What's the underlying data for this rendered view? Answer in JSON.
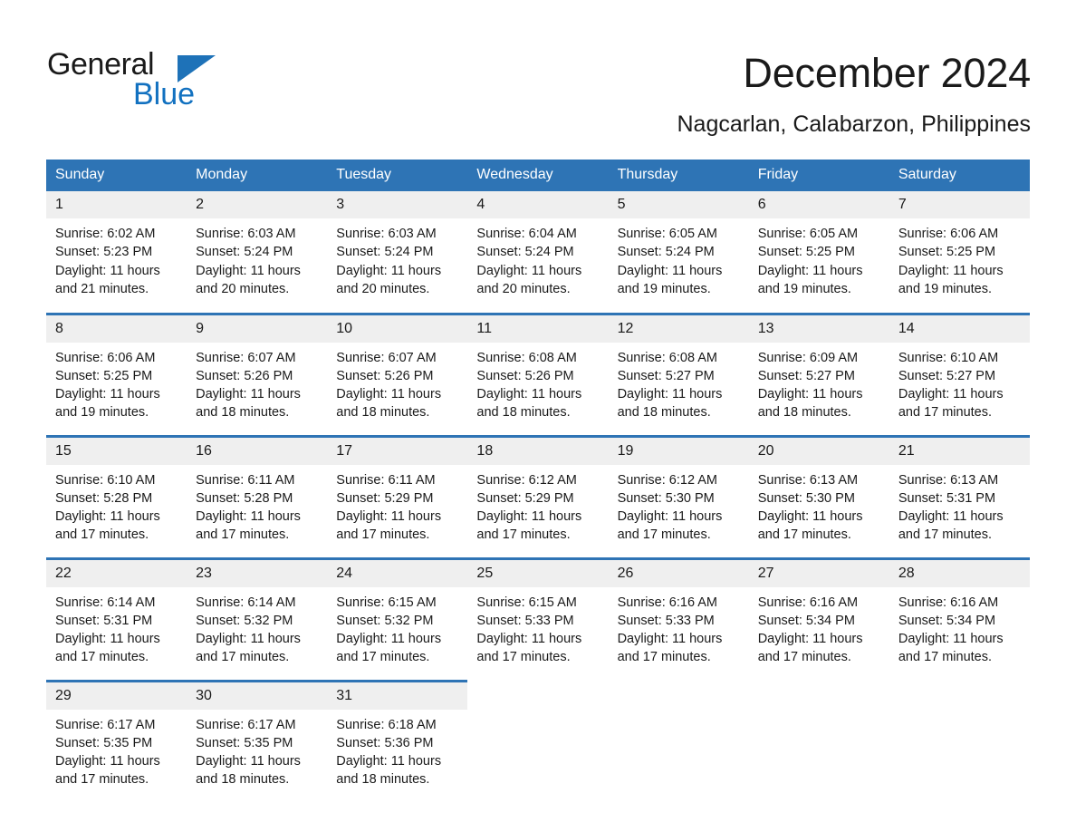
{
  "brand": {
    "name_top": "General",
    "name_bottom": "Blue",
    "accent_color": "#1271c0",
    "triangle_color": "#1e72b8"
  },
  "header": {
    "title": "December 2024",
    "location": "Nagcarlan, Calabarzon, Philippines"
  },
  "theme": {
    "header_bg": "#2e74b5",
    "daynum_bg": "#efefef",
    "text": "#1a1a1a"
  },
  "calendar": {
    "weekday_headers": [
      "Sunday",
      "Monday",
      "Tuesday",
      "Wednesday",
      "Thursday",
      "Friday",
      "Saturday"
    ],
    "labels": {
      "sunrise": "Sunrise:",
      "sunset": "Sunset:",
      "daylight": "Daylight:"
    },
    "weeks": [
      [
        {
          "day": "1",
          "sunrise": "Sunrise: 6:02 AM",
          "sunset": "Sunset: 5:23 PM",
          "daylight": "Daylight: 11 hours and 21 minutes."
        },
        {
          "day": "2",
          "sunrise": "Sunrise: 6:03 AM",
          "sunset": "Sunset: 5:24 PM",
          "daylight": "Daylight: 11 hours and 20 minutes."
        },
        {
          "day": "3",
          "sunrise": "Sunrise: 6:03 AM",
          "sunset": "Sunset: 5:24 PM",
          "daylight": "Daylight: 11 hours and 20 minutes."
        },
        {
          "day": "4",
          "sunrise": "Sunrise: 6:04 AM",
          "sunset": "Sunset: 5:24 PM",
          "daylight": "Daylight: 11 hours and 20 minutes."
        },
        {
          "day": "5",
          "sunrise": "Sunrise: 6:05 AM",
          "sunset": "Sunset: 5:24 PM",
          "daylight": "Daylight: 11 hours and 19 minutes."
        },
        {
          "day": "6",
          "sunrise": "Sunrise: 6:05 AM",
          "sunset": "Sunset: 5:25 PM",
          "daylight": "Daylight: 11 hours and 19 minutes."
        },
        {
          "day": "7",
          "sunrise": "Sunrise: 6:06 AM",
          "sunset": "Sunset: 5:25 PM",
          "daylight": "Daylight: 11 hours and 19 minutes."
        }
      ],
      [
        {
          "day": "8",
          "sunrise": "Sunrise: 6:06 AM",
          "sunset": "Sunset: 5:25 PM",
          "daylight": "Daylight: 11 hours and 19 minutes."
        },
        {
          "day": "9",
          "sunrise": "Sunrise: 6:07 AM",
          "sunset": "Sunset: 5:26 PM",
          "daylight": "Daylight: 11 hours and 18 minutes."
        },
        {
          "day": "10",
          "sunrise": "Sunrise: 6:07 AM",
          "sunset": "Sunset: 5:26 PM",
          "daylight": "Daylight: 11 hours and 18 minutes."
        },
        {
          "day": "11",
          "sunrise": "Sunrise: 6:08 AM",
          "sunset": "Sunset: 5:26 PM",
          "daylight": "Daylight: 11 hours and 18 minutes."
        },
        {
          "day": "12",
          "sunrise": "Sunrise: 6:08 AM",
          "sunset": "Sunset: 5:27 PM",
          "daylight": "Daylight: 11 hours and 18 minutes."
        },
        {
          "day": "13",
          "sunrise": "Sunrise: 6:09 AM",
          "sunset": "Sunset: 5:27 PM",
          "daylight": "Daylight: 11 hours and 18 minutes."
        },
        {
          "day": "14",
          "sunrise": "Sunrise: 6:10 AM",
          "sunset": "Sunset: 5:27 PM",
          "daylight": "Daylight: 11 hours and 17 minutes."
        }
      ],
      [
        {
          "day": "15",
          "sunrise": "Sunrise: 6:10 AM",
          "sunset": "Sunset: 5:28 PM",
          "daylight": "Daylight: 11 hours and 17 minutes."
        },
        {
          "day": "16",
          "sunrise": "Sunrise: 6:11 AM",
          "sunset": "Sunset: 5:28 PM",
          "daylight": "Daylight: 11 hours and 17 minutes."
        },
        {
          "day": "17",
          "sunrise": "Sunrise: 6:11 AM",
          "sunset": "Sunset: 5:29 PM",
          "daylight": "Daylight: 11 hours and 17 minutes."
        },
        {
          "day": "18",
          "sunrise": "Sunrise: 6:12 AM",
          "sunset": "Sunset: 5:29 PM",
          "daylight": "Daylight: 11 hours and 17 minutes."
        },
        {
          "day": "19",
          "sunrise": "Sunrise: 6:12 AM",
          "sunset": "Sunset: 5:30 PM",
          "daylight": "Daylight: 11 hours and 17 minutes."
        },
        {
          "day": "20",
          "sunrise": "Sunrise: 6:13 AM",
          "sunset": "Sunset: 5:30 PM",
          "daylight": "Daylight: 11 hours and 17 minutes."
        },
        {
          "day": "21",
          "sunrise": "Sunrise: 6:13 AM",
          "sunset": "Sunset: 5:31 PM",
          "daylight": "Daylight: 11 hours and 17 minutes."
        }
      ],
      [
        {
          "day": "22",
          "sunrise": "Sunrise: 6:14 AM",
          "sunset": "Sunset: 5:31 PM",
          "daylight": "Daylight: 11 hours and 17 minutes."
        },
        {
          "day": "23",
          "sunrise": "Sunrise: 6:14 AM",
          "sunset": "Sunset: 5:32 PM",
          "daylight": "Daylight: 11 hours and 17 minutes."
        },
        {
          "day": "24",
          "sunrise": "Sunrise: 6:15 AM",
          "sunset": "Sunset: 5:32 PM",
          "daylight": "Daylight: 11 hours and 17 minutes."
        },
        {
          "day": "25",
          "sunrise": "Sunrise: 6:15 AM",
          "sunset": "Sunset: 5:33 PM",
          "daylight": "Daylight: 11 hours and 17 minutes."
        },
        {
          "day": "26",
          "sunrise": "Sunrise: 6:16 AM",
          "sunset": "Sunset: 5:33 PM",
          "daylight": "Daylight: 11 hours and 17 minutes."
        },
        {
          "day": "27",
          "sunrise": "Sunrise: 6:16 AM",
          "sunset": "Sunset: 5:34 PM",
          "daylight": "Daylight: 11 hours and 17 minutes."
        },
        {
          "day": "28",
          "sunrise": "Sunrise: 6:16 AM",
          "sunset": "Sunset: 5:34 PM",
          "daylight": "Daylight: 11 hours and 17 minutes."
        }
      ],
      [
        {
          "day": "29",
          "sunrise": "Sunrise: 6:17 AM",
          "sunset": "Sunset: 5:35 PM",
          "daylight": "Daylight: 11 hours and 17 minutes."
        },
        {
          "day": "30",
          "sunrise": "Sunrise: 6:17 AM",
          "sunset": "Sunset: 5:35 PM",
          "daylight": "Daylight: 11 hours and 18 minutes."
        },
        {
          "day": "31",
          "sunrise": "Sunrise: 6:18 AM",
          "sunset": "Sunset: 5:36 PM",
          "daylight": "Daylight: 11 hours and 18 minutes."
        },
        {
          "day": "",
          "sunrise": "",
          "sunset": "",
          "daylight": ""
        },
        {
          "day": "",
          "sunrise": "",
          "sunset": "",
          "daylight": ""
        },
        {
          "day": "",
          "sunrise": "",
          "sunset": "",
          "daylight": ""
        },
        {
          "day": "",
          "sunrise": "",
          "sunset": "",
          "daylight": ""
        }
      ]
    ]
  }
}
